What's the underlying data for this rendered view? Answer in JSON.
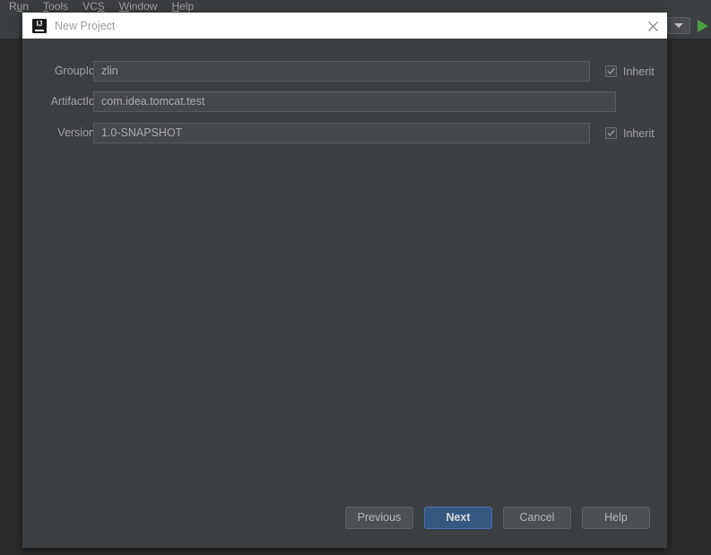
{
  "menubar": {
    "items": [
      {
        "pre": "R",
        "mn": "u",
        "post": "n"
      },
      {
        "pre": "",
        "mn": "T",
        "post": "ools"
      },
      {
        "pre": "VC",
        "mn": "S",
        "post": ""
      },
      {
        "pre": "",
        "mn": "W",
        "post": "indow"
      },
      {
        "pre": "",
        "mn": "H",
        "post": "elp"
      }
    ]
  },
  "toolbar": {
    "combo_arrow_icon": "chevron-down-icon",
    "run_icon": "run-triangle-icon"
  },
  "dialog": {
    "title": "New Project",
    "app_icon": "intellij-idea-icon",
    "app_icon_text": "IJ",
    "close_icon": "close-icon",
    "fields": [
      {
        "label": "GroupId",
        "value": "zlin",
        "width": "short",
        "inherit": {
          "label": "Inherit",
          "checked": true
        }
      },
      {
        "label": "ArtifactId",
        "value": "com.idea.tomcat.test",
        "width": "long",
        "inherit": null
      },
      {
        "label": "Version",
        "value": "1.0-SNAPSHOT",
        "width": "short",
        "inherit": {
          "label": "Inherit",
          "checked": true
        }
      }
    ],
    "buttons": {
      "previous": "Previous",
      "next": "Next",
      "cancel": "Cancel",
      "help": "Help"
    }
  },
  "colors": {
    "desktop_background": "#2b2b2b",
    "panel_background": "#3c3f41",
    "titlebar_background": "#ffffff",
    "input_background": "#45484a",
    "accent_button": "#365880",
    "run_green": "#4a9e47"
  }
}
